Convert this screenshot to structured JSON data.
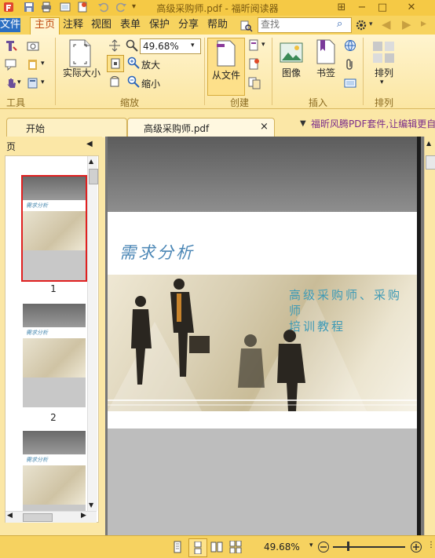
{
  "window": {
    "title": "高级采购师.pdf - 福昕阅读器",
    "min_label": "−",
    "max_label": "□",
    "close_label": "✕"
  },
  "menu": {
    "file": "文件",
    "home": "主页",
    "annotate": "注释",
    "view": "视图",
    "form": "表单",
    "protect": "保护",
    "share": "分享",
    "help": "帮助"
  },
  "search": {
    "placeholder": "查找",
    "value": ""
  },
  "ribbon": {
    "tools_label": "工具",
    "zoom": {
      "actual_size": "实际大小",
      "zoom_value": "49.68%",
      "zoom_in": "放大",
      "zoom_out": "缩小",
      "group_label": "缩放"
    },
    "create": {
      "from_file": "从文件",
      "group_label": "创建"
    },
    "insert": {
      "image": "图像",
      "bookmark": "书签",
      "group_label": "插入"
    },
    "arrange": {
      "arrange": "排列",
      "group_label": "排列"
    }
  },
  "tabs": {
    "start": "开始",
    "doc": "高级采购师.pdf",
    "close": "×",
    "promo": "福昕风腾PDF套件,让编辑更自由"
  },
  "panel": {
    "title": "页",
    "pages": [
      "1",
      "2"
    ]
  },
  "document": {
    "heading": "需求分析",
    "subheading_line1": "高级采购师、采购师",
    "subheading_line2": "培训教程",
    "thumb_caption": "需求分析"
  },
  "statusbar": {
    "zoom": "49.68%"
  },
  "colors": {
    "accent": "#f5c945",
    "file_menu": "#2b6fc2",
    "heading": "#4a86b5"
  }
}
